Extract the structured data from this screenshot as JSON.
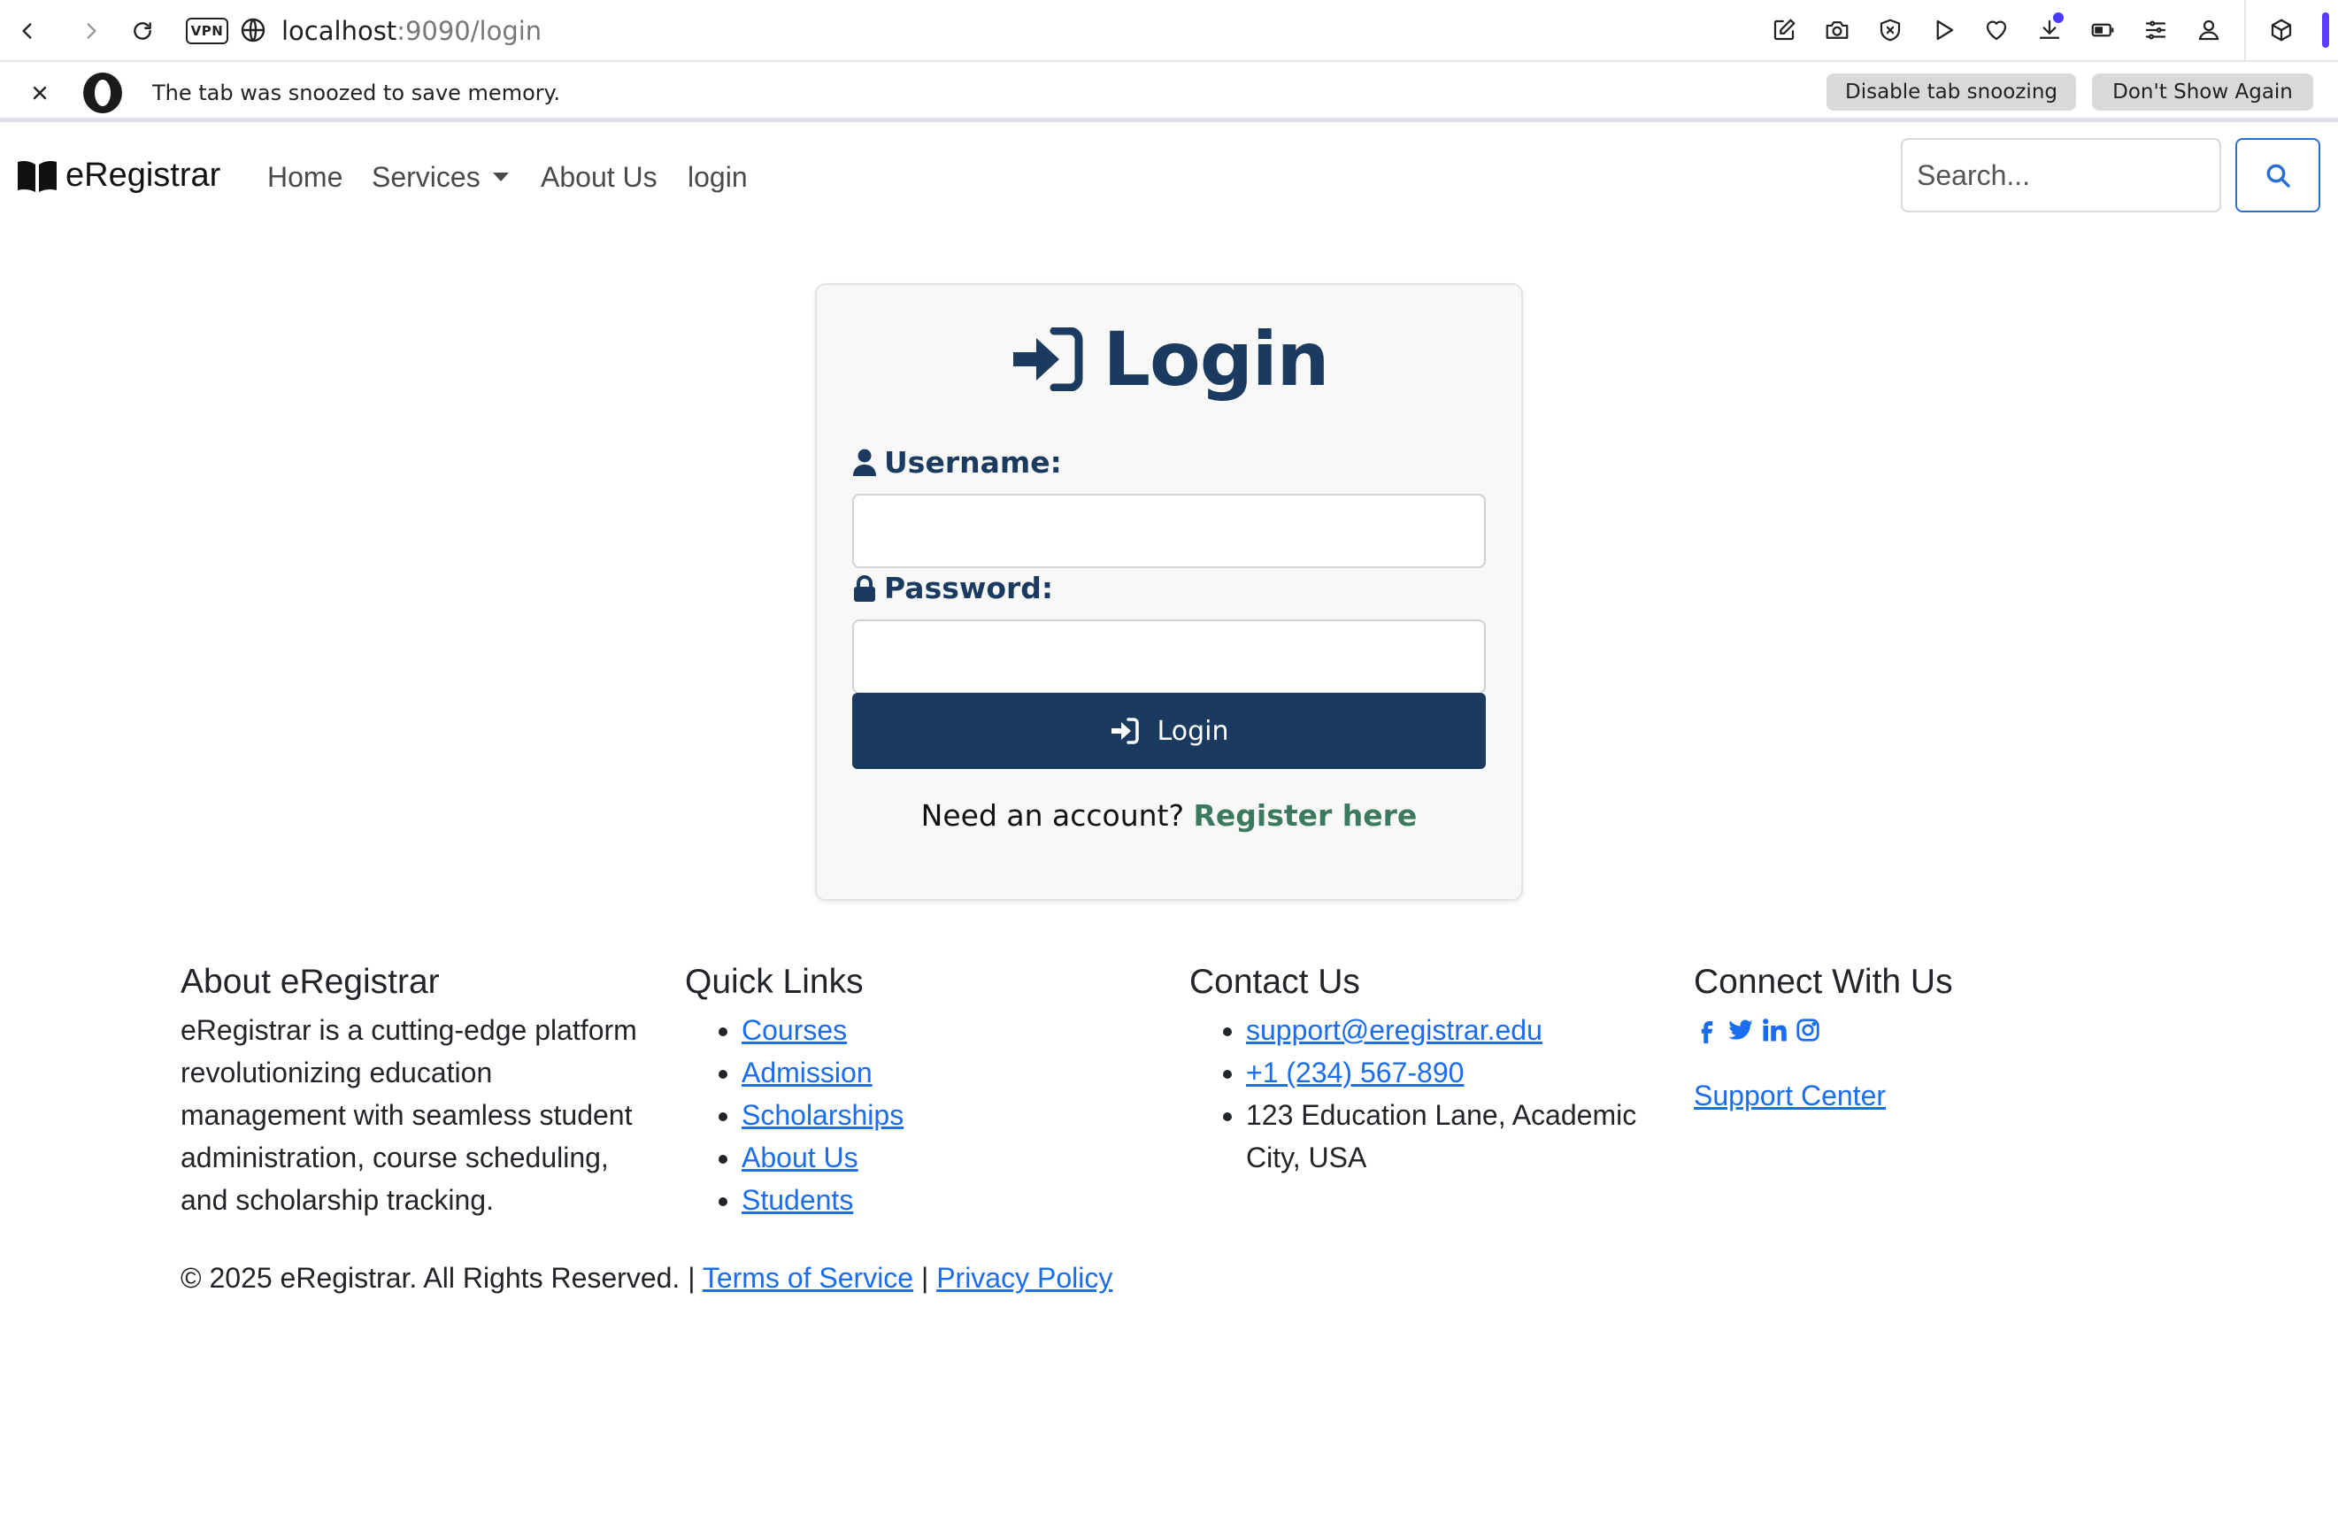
{
  "browser": {
    "url_host": "localhost",
    "url_path": ":9090/login",
    "vpn_label": "VPN"
  },
  "snooze": {
    "message": "The tab was snoozed to save memory.",
    "disable_label": "Disable tab snoozing",
    "dismiss_label": "Don't Show Again"
  },
  "navbar": {
    "brand": "eRegistrar",
    "links": [
      "Home",
      "Services",
      "About Us",
      "login"
    ],
    "search_placeholder": "Search..."
  },
  "login": {
    "title": "Login",
    "username_label": "Username:",
    "password_label": "Password:",
    "submit_label": "Login",
    "register_prompt": "Need an account?",
    "register_link": "Register here"
  },
  "footer": {
    "about": {
      "heading": "About eRegistrar",
      "text": "eRegistrar is a cutting-edge platform revolutionizing education management with seamless student administration, course scheduling, and scholarship tracking."
    },
    "quick_links": {
      "heading": "Quick Links",
      "items": [
        "Courses",
        "Admission",
        "Scholarships",
        "About Us",
        "Students"
      ]
    },
    "contact": {
      "heading": "Contact Us",
      "email": "support@eregistrar.edu",
      "phone": "+1 (234) 567-890",
      "address": "123 Education Lane, Academic City, USA"
    },
    "connect": {
      "heading": "Connect With Us",
      "social_icons": [
        "facebook-icon",
        "twitter-icon",
        "linkedin-icon",
        "instagram-icon"
      ],
      "support_link": "Support Center"
    },
    "copyright": "© 2025 eRegistrar. All Rights Reserved. |",
    "terms_link": "Terms of Service",
    "separator": "|",
    "privacy_link": "Privacy Policy"
  },
  "colors": {
    "primary": "#1a3a5f",
    "link": "#1a6cf0",
    "register": "#3b7a5e",
    "accent": "#5a3dff"
  }
}
